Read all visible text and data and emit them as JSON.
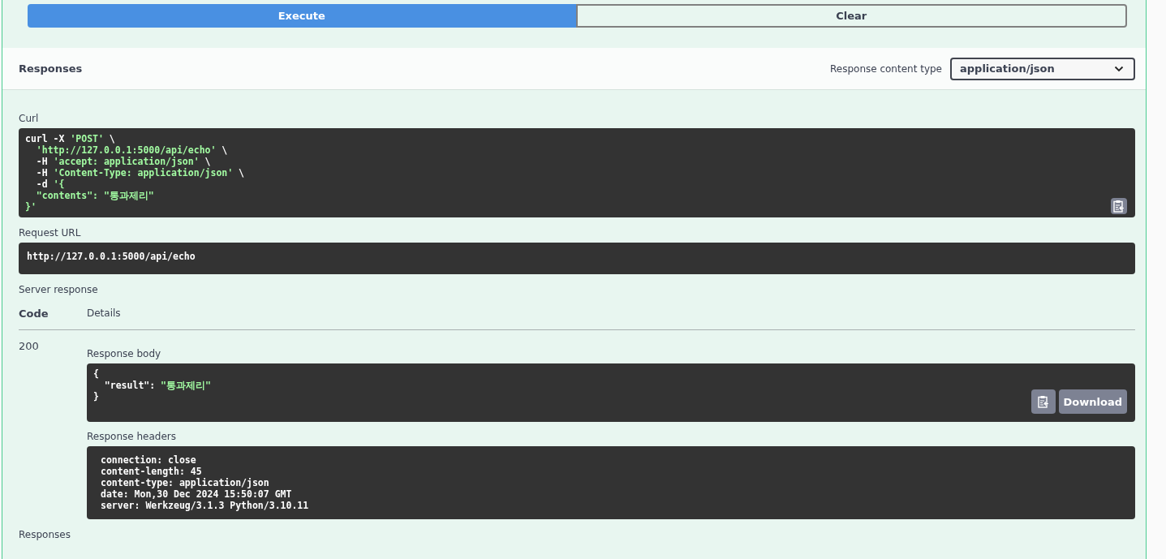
{
  "actions": [
    {
      "label": "Execute",
      "kind": "primary"
    },
    {
      "label": "Clear",
      "kind": "secondary"
    }
  ],
  "responses_header": {
    "title": "Responses",
    "content_type_label": "Response content type",
    "content_type": "application/json"
  },
  "curl": {
    "label": "Curl",
    "lines": [
      [
        {
          "text": "curl -X ",
          "kind": "plain"
        },
        {
          "text": "'POST'",
          "kind": "string"
        },
        {
          "text": " \\",
          "kind": "plain"
        }
      ],
      [
        {
          "text": "  'http://127.0.0.1:5000/api/echo'",
          "kind": "string"
        },
        {
          "text": " \\",
          "kind": "plain"
        }
      ],
      [
        {
          "text": "  -H ",
          "kind": "plain"
        },
        {
          "text": "'accept: application/json'",
          "kind": "string"
        },
        {
          "text": " \\",
          "kind": "plain"
        }
      ],
      [
        {
          "text": "  -H ",
          "kind": "plain"
        },
        {
          "text": "'Content-Type: application/json'",
          "kind": "string"
        },
        {
          "text": " \\",
          "kind": "plain"
        }
      ],
      [
        {
          "text": "  -d ",
          "kind": "plain"
        },
        {
          "text": "'{",
          "kind": "string"
        }
      ],
      [
        {
          "text": "  \"contents\": \"통과제리\"",
          "kind": "string"
        }
      ],
      [
        {
          "text": "}'",
          "kind": "string"
        }
      ]
    ]
  },
  "request_url": {
    "label": "Request URL",
    "value": "http://127.0.0.1:5000/api/echo"
  },
  "server_response": {
    "label": "Server response",
    "columns": [
      "Code",
      "Details"
    ],
    "code": "200",
    "body_label": "Response body",
    "body_lines": [
      [
        {
          "text": "{",
          "kind": "plain"
        }
      ],
      [
        {
          "text": "  \"result\": ",
          "kind": "plain"
        },
        {
          "text": "\"통과제리\"",
          "kind": "string"
        }
      ],
      [
        {
          "text": "}",
          "kind": "plain"
        }
      ]
    ],
    "download": "Download",
    "headers_label": "Response headers",
    "headers": [
      "connection: close",
      "content-length: 45",
      "content-type: application/json",
      "date: Mon,30 Dec 2024 15:50:07 GMT",
      "server: Werkzeug/3.1.3 Python/3.10.11"
    ]
  },
  "footer_label": "Responses"
}
